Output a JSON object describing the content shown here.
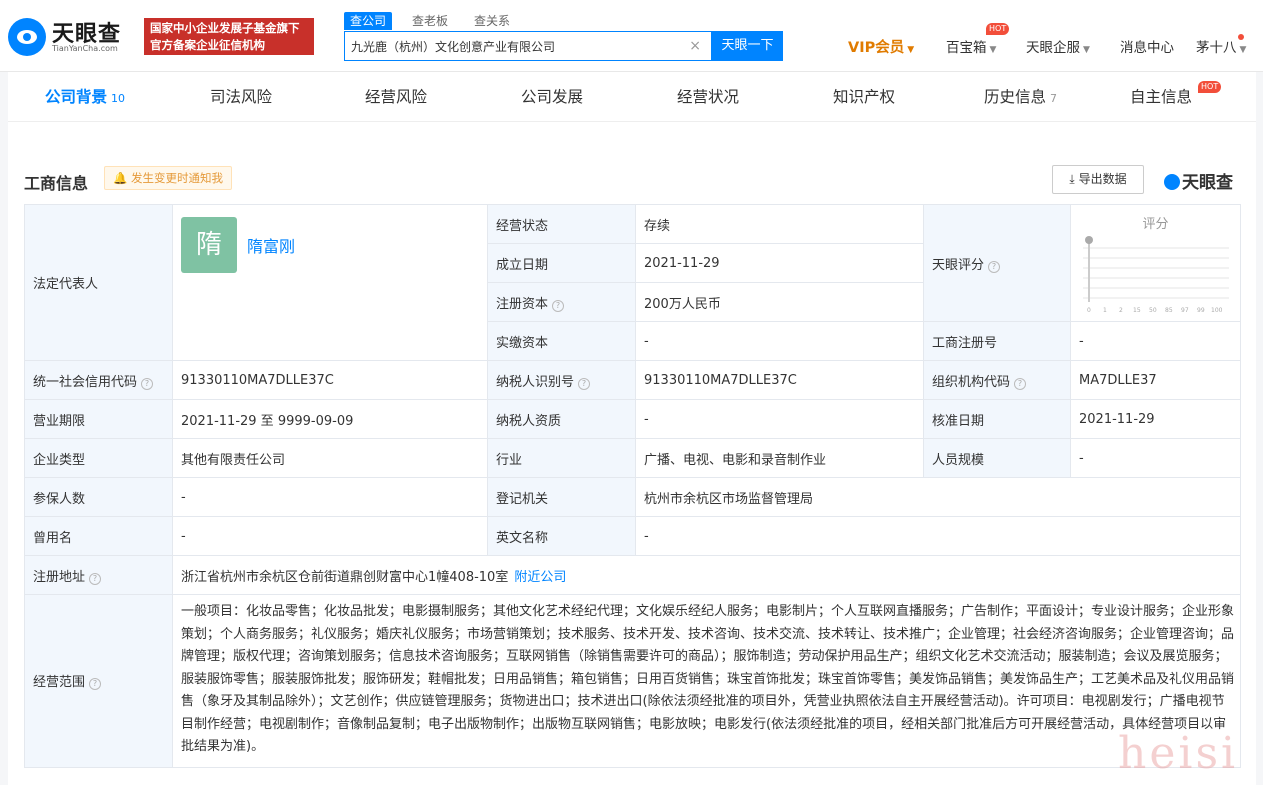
{
  "header": {
    "logo_cn": "天眼查",
    "logo_en": "TianYanCha.com",
    "banner_line1": "国家中小企业发展子基金旗下",
    "banner_line2": "官方备案企业征信机构",
    "search_tabs": [
      "查公司",
      "查老板",
      "查关系"
    ],
    "search_value": "九光鹿（杭州）文化创意产业有限公司",
    "search_clear": "×",
    "search_button": "天眼一下",
    "vip": "VIP会员",
    "baibaoxiang": "百宝箱",
    "hot": "HOT",
    "enterprise": "天眼企服",
    "messages": "消息中心",
    "user": "茅十八"
  },
  "tabs": [
    {
      "label": "公司背景",
      "count": "10"
    },
    {
      "label": "司法风险",
      "count": ""
    },
    {
      "label": "经营风险",
      "count": ""
    },
    {
      "label": "公司发展",
      "count": ""
    },
    {
      "label": "经营状况",
      "count": ""
    },
    {
      "label": "知识产权",
      "count": ""
    },
    {
      "label": "历史信息",
      "count": "7"
    },
    {
      "label": "自主信息",
      "count": ""
    }
  ],
  "tab_hot": "HOT",
  "section": {
    "title": "工商信息",
    "notify": "发生变更时通知我",
    "export": "导出数据",
    "brand": "天眼查"
  },
  "info": {
    "legal_rep_label": "法定代表人",
    "legal_rep_avatar": "隋",
    "legal_rep_name": "隋富刚",
    "status_label": "经营状态",
    "status": "存续",
    "established_label": "成立日期",
    "established": "2021-11-29",
    "reg_capital_label": "注册资本",
    "reg_capital": "200万人民币",
    "paid_capital_label": "实缴资本",
    "paid_capital": "-",
    "score_label": "天眼评分",
    "score_title": "评分",
    "score_scale": [
      "0",
      "1",
      "2",
      "15",
      "50",
      "85",
      "97",
      "99",
      "100"
    ],
    "reg_no_label": "工商注册号",
    "reg_no": "-",
    "credit_code_label": "统一社会信用代码",
    "credit_code": "91330110MA7DLLE37C",
    "taxpayer_id_label": "纳税人识别号",
    "taxpayer_id": "91330110MA7DLLE37C",
    "org_code_label": "组织机构代码",
    "org_code": "MA7DLLE37",
    "term_label": "营业期限",
    "term": "2021-11-29  至 9999-09-09",
    "taxpayer_qual_label": "纳税人资质",
    "taxpayer_qual": "-",
    "approval_label": "核准日期",
    "approval": "2021-11-29",
    "type_label": "企业类型",
    "type": "其他有限责任公司",
    "industry_label": "行业",
    "industry": "广播、电视、电影和录音制作业",
    "staff_label": "人员规模",
    "staff": "-",
    "insured_label": "参保人数",
    "insured": "-",
    "authority_label": "登记机关",
    "authority": "杭州市余杭区市场监督管理局",
    "former_label": "曾用名",
    "former": "-",
    "english_label": "英文名称",
    "english": "-",
    "address_label": "注册地址",
    "address": "浙江省杭州市余杭区仓前街道鼎创财富中心1幢408-10室",
    "nearby": "附近公司",
    "scope_label": "经营范围",
    "scope": "一般项目：化妆品零售；化妆品批发；电影摄制服务；其他文化艺术经纪代理；文化娱乐经纪人服务；电影制片；个人互联网直播服务；广告制作；平面设计；专业设计服务；企业形象策划；个人商务服务；礼仪服务；婚庆礼仪服务；市场营销策划；技术服务、技术开发、技术咨询、技术交流、技术转让、技术推广；企业管理；社会经济咨询服务；企业管理咨询；品牌管理；版权代理；咨询策划服务；信息技术咨询服务；互联网销售（除销售需要许可的商品）；服饰制造；劳动保护用品生产；组织文化艺术交流活动；服装制造；会议及展览服务；服装服饰零售；服装服饰批发；服饰研发；鞋帽批发；日用品销售；箱包销售；日用百货销售；珠宝首饰批发；珠宝首饰零售；美发饰品销售；美发饰品生产；工艺美术品及礼仪用品销售（象牙及其制品除外）；文艺创作；供应链管理服务；货物进出口；技术进出口(除依法须经批准的项目外，凭营业执照依法自主开展经营活动)。许可项目：电视剧发行；广播电视节目制作经营；电视剧制作；音像制品复制；电子出版物制作；出版物互联网销售；电影放映；电影发行(依法须经批准的项目，经相关部门批准后方可开展经营活动，具体经营项目以审批结果为准)。"
  },
  "watermark": "heisi"
}
